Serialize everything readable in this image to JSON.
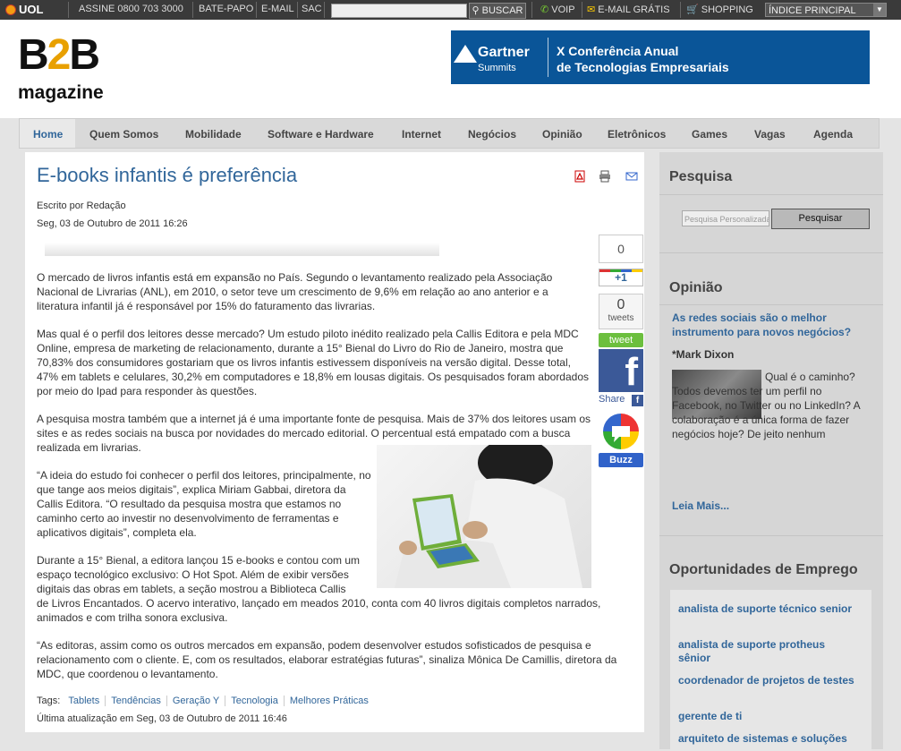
{
  "uolbar": {
    "logo": "UOL",
    "assine": "ASSINE 0800 703 3000",
    "batepapo": "BATE-PAPO",
    "email": "E-MAIL",
    "sac": "SAC",
    "search_button": "BUSCAR",
    "voip": "VOIP",
    "email_gratis": "E-MAIL GRÁTIS",
    "shopping": "SHOPPING",
    "index": "ÍNDICE PRINCIPAL"
  },
  "header": {
    "logo_b": "B",
    "logo_2": "2",
    "logo_b2": "B",
    "logo_magazine": "magazine",
    "banner_brand": "Gartner",
    "banner_sub": "Summits",
    "banner_line1": "X Conferência Anual",
    "banner_line2": "de Tecnologias Empresariais"
  },
  "nav": {
    "tabs": [
      "Home",
      "Quem Somos",
      "Mobilidade",
      "Software e Hardware",
      "Internet",
      "Negócios",
      "Opinião",
      "Eletrônicos",
      "Games",
      "Vagas",
      "Agenda"
    ],
    "active": "Home"
  },
  "article": {
    "title": "E-books infantis é preferência",
    "author": "Escrito por Redação",
    "date": "Seg, 03 de Outubro de 2011 16:26",
    "p1": "O mercado de livros infantis está em expansão no País. Segundo o levantamento realizado pela Associação Nacional de Livrarias (ANL), em 2010, o setor teve um crescimento de 9,6% em relação ao ano anterior e a literatura infantil já é responsável por 15% do faturamento das livrarias.",
    "p2": "Mas qual é o perfil dos leitores desse mercado? Um estudo piloto inédito realizado pela Callis Editora e pela MDC Online, empresa de marketing de relacionamento, durante a 15° Bienal do Livro do Rio de Janeiro, mostra que 70,83% dos consumidores gostariam que os livros infantis estivessem disponíveis na versão digital. Desse total, 47% em tablets e celulares, 30,2% em computadores e 18,8% em lousas digitais. Os pesquisados foram abordados por meio do Ipad para responder às questões.",
    "p3": "A pesquisa mostra também que a internet já é uma importante fonte de pesquisa. Mais de 37% dos leitores usam os sites e as redes sociais na busca por novidades do mercado editorial. O percentual está empatado com a busca realizada em livrarias.",
    "p4": "“A ideia do estudo foi conhecer o perfil dos leitores, principalmente, no que tange aos meios digitais”, explica Miriam Gabbai, diretora da Callis Editora. “O resultado da pesquisa mostra que estamos no caminho certo ao investir no desenvolvimento de ferramentas e aplicativos digitais”, completa ela.",
    "p5a": "Durante a 15° Bienal, a editora lançou 15 e-books e contou com um espaço tecnológico exclusivo: O Hot Spot. Além de exibir versões digitais das obras em tablets, a seção mostrou a Biblioteca Callis",
    "p5b": "de Livros Encantados. O acervo interativo, lançado em meados 2010, conta com 40 livros digitais completos narrados, animados e com trilha sonora exclusiva.",
    "p6": "“As editoras, assim como os outros mercados em expansão, podem desenvolver estudos sofisticados de pesquisa e relacionamento com o cliente. E, com os resultados, elaborar estratégias futuras”, sinaliza Mônica De Camillis, diretora da MDC, que coordenou o levantamento.",
    "tags_label": "Tags:",
    "tags": [
      "Tablets",
      "Tendências",
      "Geração Y",
      "Tecnologia",
      "Melhores Práticas"
    ],
    "updated": "Última atualização em Seg, 03 de Outubro de 2011 16:46"
  },
  "share": {
    "gplus_count": "0",
    "gplus_label": "+1",
    "tweet_count": "0",
    "tweet_count_label": "tweets",
    "tweet_button": "tweet",
    "fb_letter": "f",
    "fb_share": "Share",
    "buzz": "Buzz"
  },
  "sidebar": {
    "search_title": "Pesquisa",
    "search_placeholder": "Pesquisa Personalizada",
    "search_button": "Pesquisar",
    "opinion_title": "Opinião",
    "opinion_link": "As redes sociais são o melhor instrumento para novos negócios?",
    "opinion_author": "*Mark Dixon",
    "opinion_text": "Qual é o caminho? Todos devemos ter um perfil no Facebook, no Twitter ou no LinkedIn? A colaboração é a única forma de fazer negócios hoje? De jeito nenhum",
    "opinion_more": "Leia Mais...",
    "jobs_title": "Oportunidades de Emprego",
    "jobs": [
      "analista de suporte técnico senior",
      "analista de suporte protheus sênior",
      "coordenador de projetos de testes",
      "gerente de ti",
      "arquiteto de sistemas e soluções"
    ]
  },
  "colors": {
    "link": "#31669a",
    "uolbar": "#3a3a3a",
    "banner": "#0a5598",
    "tweet": "#6cbf3e",
    "facebook": "#3b5998"
  }
}
